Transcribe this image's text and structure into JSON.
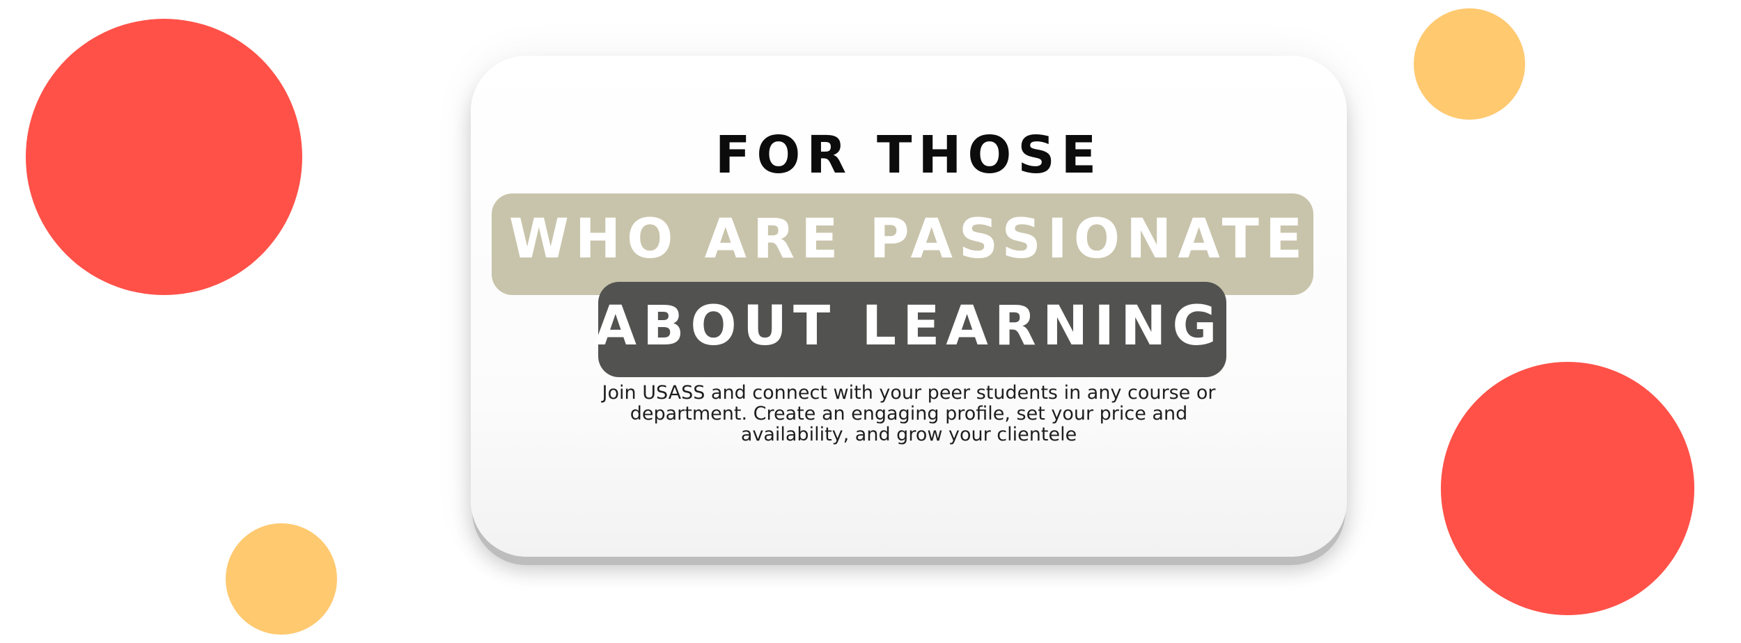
{
  "colors": {
    "accent_red": "#ff5148",
    "accent_yellow": "#ffc970",
    "band_beige": "#c8c4ab",
    "band_dark": "#525350",
    "headline_dark": "#0c0c0c",
    "background": "#ffffff"
  },
  "decorations": {
    "circles": [
      {
        "name": "red-circle-top-left",
        "color": "#ff5148"
      },
      {
        "name": "yellow-circle-top-right",
        "color": "#ffc970"
      },
      {
        "name": "yellow-circle-bottom-left",
        "color": "#ffc970"
      },
      {
        "name": "red-circle-bottom-right",
        "color": "#ff5148"
      }
    ]
  },
  "card": {
    "heading_line1": "FOR THOSE",
    "heading_line2": "WHO ARE PASSIONATE",
    "heading_line3": "ABOUT LEARNING",
    "body_lines": [
      "Join USASS and connect with your peer students  in any course or",
      "department. Create an engaging profile, set your price and",
      "availability, and grow your clientele"
    ]
  }
}
